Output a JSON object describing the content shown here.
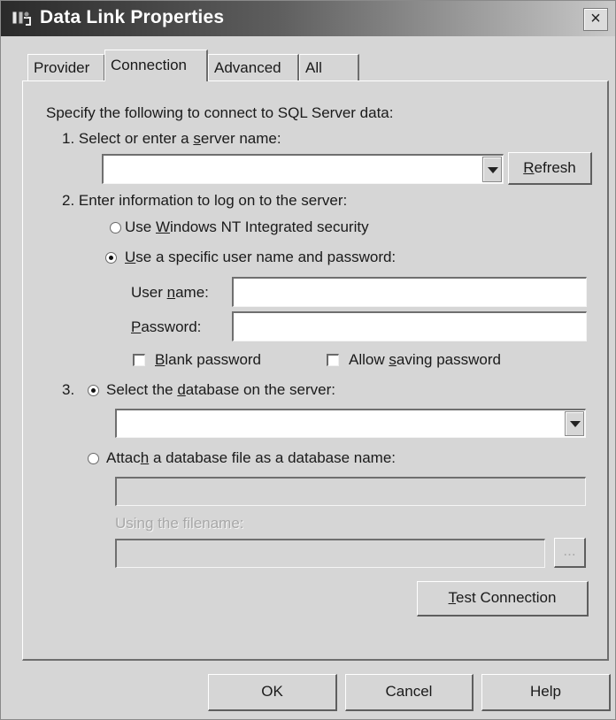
{
  "window": {
    "title": "Data Link Properties",
    "close_glyph": "×"
  },
  "tabs": [
    {
      "label": "Provider",
      "active": false
    },
    {
      "label": "Connection",
      "active": true
    },
    {
      "label": "Advanced",
      "active": false
    },
    {
      "label": "All",
      "active": false
    }
  ],
  "connection": {
    "intro": "Specify the following to connect to SQL Server data:",
    "step1": {
      "label_pre": "1. Select or enter a ",
      "label_u": "s",
      "label_post": "erver name:",
      "server_value": "",
      "refresh_u": "R",
      "refresh_rest": "efresh"
    },
    "step2": {
      "label": "2. Enter information to log on to the server:",
      "opt_nt_pre": "Use ",
      "opt_nt_u": "W",
      "opt_nt_post": "indows NT Integrated security",
      "opt_nt_checked": false,
      "opt_specific_u": "U",
      "opt_specific_post": "se a specific user name and password:",
      "opt_specific_checked": true,
      "user_label_pre": "User ",
      "user_label_u": "n",
      "user_label_post": "ame:",
      "user_value": "",
      "password_label_u": "P",
      "password_label_post": "assword:",
      "password_value": "",
      "blank_pw_u": "B",
      "blank_pw_post": "lank password",
      "blank_pw_checked": false,
      "allow_save_pre": "Allow ",
      "allow_save_u": "s",
      "allow_save_post": "aving password",
      "allow_save_checked": false
    },
    "step3": {
      "number": "3.",
      "opt_select_pre": "Select the ",
      "opt_select_u": "d",
      "opt_select_post": "atabase on the server:",
      "opt_select_checked": true,
      "database_value": "",
      "opt_attach_pre": "Attac",
      "opt_attach_u": "h",
      "opt_attach_post": " a database file as a database name:",
      "opt_attach_checked": false,
      "attach_name_value": "",
      "filename_label": "Using the filename:",
      "filename_value": "",
      "browse_label": "..."
    },
    "test_u": "T",
    "test_rest": "est Connection"
  },
  "footer": {
    "ok": "OK",
    "cancel": "Cancel",
    "help": "Help"
  }
}
